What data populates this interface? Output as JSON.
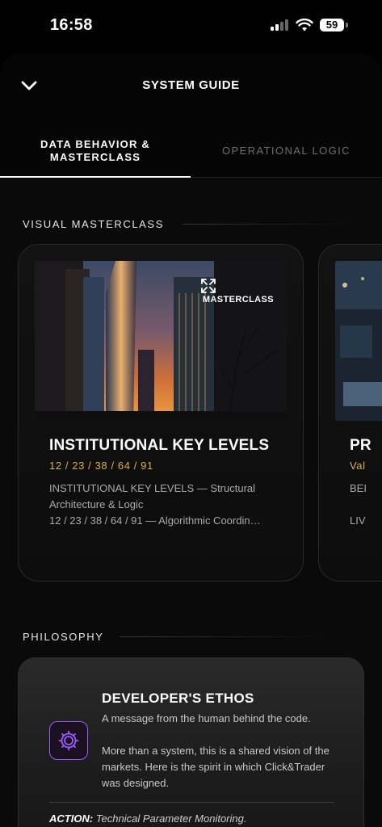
{
  "status": {
    "time": "16:58",
    "battery": "59"
  },
  "header": {
    "title": "SYSTEM GUIDE"
  },
  "tabs": [
    {
      "label": "DATA BEHAVIOR &\nMASTERCLASS",
      "active": true
    },
    {
      "label": "OPERATIONAL LOGIC",
      "active": false
    }
  ],
  "sections": {
    "masterclass": "VISUAL MASTERCLASS",
    "philosophy": "PHILOSOPHY"
  },
  "cards": [
    {
      "badge": "MASTERCLASS",
      "title": "INSTITUTIONAL KEY LEVELS",
      "subtitle": "12 / 23 / 38 / 64 / 91",
      "desc_line1": "INSTITUTIONAL KEY LEVELS — Structural Architecture & Logic",
      "desc_line2": "12 / 23 / 38 / 64 / 91 — Algorithmic Coordin…"
    },
    {
      "title": "PR",
      "subtitle": "Val",
      "desc_line1": "BEI",
      "desc_line2": "LIV"
    }
  ],
  "ethos": {
    "title": "DEVELOPER'S ETHOS",
    "lead": "A message from the human behind the code.",
    "body": "More than a system, this is a shared vision of the markets. Here is the spirit in which Click&Trader was designed.",
    "action_label": "ACTION:",
    "action_text": "Technical Parameter Monitoring."
  },
  "colors": {
    "accent_gold": "#d8b04a",
    "accent_purple": "#9b5cff"
  },
  "icons": [
    "chevron-down-icon",
    "expand-icon",
    "gear-icon",
    "wifi-icon",
    "signal-icon",
    "battery-icon"
  ]
}
